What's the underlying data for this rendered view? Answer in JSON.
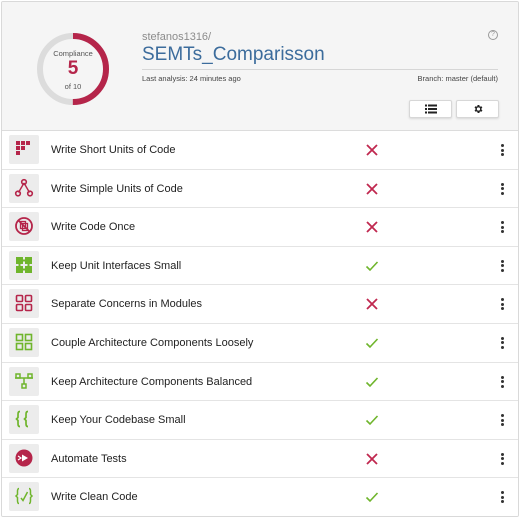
{
  "compliance": {
    "label": "Compliance",
    "value": "5",
    "total_text": "of 10",
    "fraction": 0.5,
    "color": "#b5254a"
  },
  "repository": {
    "owner": "stefanos1316/",
    "name": "SEMTs_Comparisson",
    "last_analysis": "Last analysis: 24 minutes ago",
    "branch": "Branch: master (default)"
  },
  "toolbar": {
    "help_icon": "?",
    "list_icon": "list-icon",
    "settings_icon": "gear-icon"
  },
  "colors": {
    "fail": "#c0284f",
    "pass": "#6fb52c"
  },
  "guidelines": [
    {
      "label": "Write Short Units of Code",
      "icon": "short-units-icon",
      "status": "fail"
    },
    {
      "label": "Write Simple Units of Code",
      "icon": "simple-units-icon",
      "status": "fail"
    },
    {
      "label": "Write Code Once",
      "icon": "code-once-icon",
      "status": "fail"
    },
    {
      "label": "Keep Unit Interfaces Small",
      "icon": "unit-interfaces-icon",
      "status": "pass"
    },
    {
      "label": "Separate Concerns in Modules",
      "icon": "separate-concerns-icon",
      "status": "fail"
    },
    {
      "label": "Couple Architecture Components Loosely",
      "icon": "couple-components-icon",
      "status": "pass"
    },
    {
      "label": "Keep Architecture Components Balanced",
      "icon": "balanced-components-icon",
      "status": "pass"
    },
    {
      "label": "Keep Your Codebase Small",
      "icon": "small-codebase-icon",
      "status": "pass"
    },
    {
      "label": "Automate Tests",
      "icon": "automate-tests-icon",
      "status": "fail"
    },
    {
      "label": "Write Clean Code",
      "icon": "clean-code-icon",
      "status": "pass"
    }
  ]
}
